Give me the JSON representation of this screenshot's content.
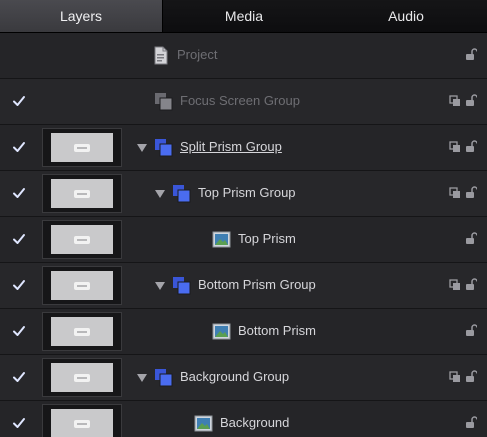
{
  "tabs": [
    {
      "label": "Layers",
      "active": true
    },
    {
      "label": "Media",
      "active": false
    },
    {
      "label": "Audio",
      "active": false
    }
  ],
  "colors": {
    "accent_blue": "#4a6cf0",
    "checkmark": "#dfe6ff",
    "icon_gray": "#9a9aa0"
  },
  "layers": [
    {
      "label": "Project",
      "icon": "project-document-icon",
      "checked": false,
      "thumbnail": false,
      "disclosure": false,
      "indent": 0,
      "dim": true,
      "group_icon": false
    },
    {
      "label": "Focus Screen Group",
      "icon": "group-icon",
      "checked": true,
      "thumbnail": false,
      "disclosure": false,
      "indent": 0,
      "dim": true,
      "group_icon": true
    },
    {
      "label": "Split Prism Group",
      "icon": "group-icon",
      "checked": true,
      "thumbnail": true,
      "disclosure": true,
      "indent": 0,
      "dim": false,
      "group_icon": true,
      "underline": true
    },
    {
      "label": "Top Prism Group",
      "icon": "group-icon",
      "checked": true,
      "thumbnail": true,
      "disclosure": true,
      "indent": 1,
      "dim": false,
      "group_icon": true
    },
    {
      "label": "Top Prism",
      "icon": "image-layer-icon",
      "checked": true,
      "thumbnail": true,
      "disclosure": false,
      "indent": 2,
      "dim": false,
      "group_icon": false
    },
    {
      "label": "Bottom Prism Group",
      "icon": "group-icon",
      "checked": true,
      "thumbnail": true,
      "disclosure": true,
      "indent": 1,
      "dim": false,
      "group_icon": true
    },
    {
      "label": "Bottom Prism",
      "icon": "image-layer-icon",
      "checked": true,
      "thumbnail": true,
      "disclosure": false,
      "indent": 2,
      "dim": false,
      "group_icon": false
    },
    {
      "label": "Background Group",
      "icon": "group-icon",
      "checked": true,
      "thumbnail": true,
      "disclosure": true,
      "indent": 0,
      "dim": false,
      "group_icon": true
    },
    {
      "label": "Background",
      "icon": "image-layer-icon",
      "checked": true,
      "thumbnail": true,
      "disclosure": false,
      "indent": 1,
      "dim": false,
      "group_icon": false
    }
  ]
}
